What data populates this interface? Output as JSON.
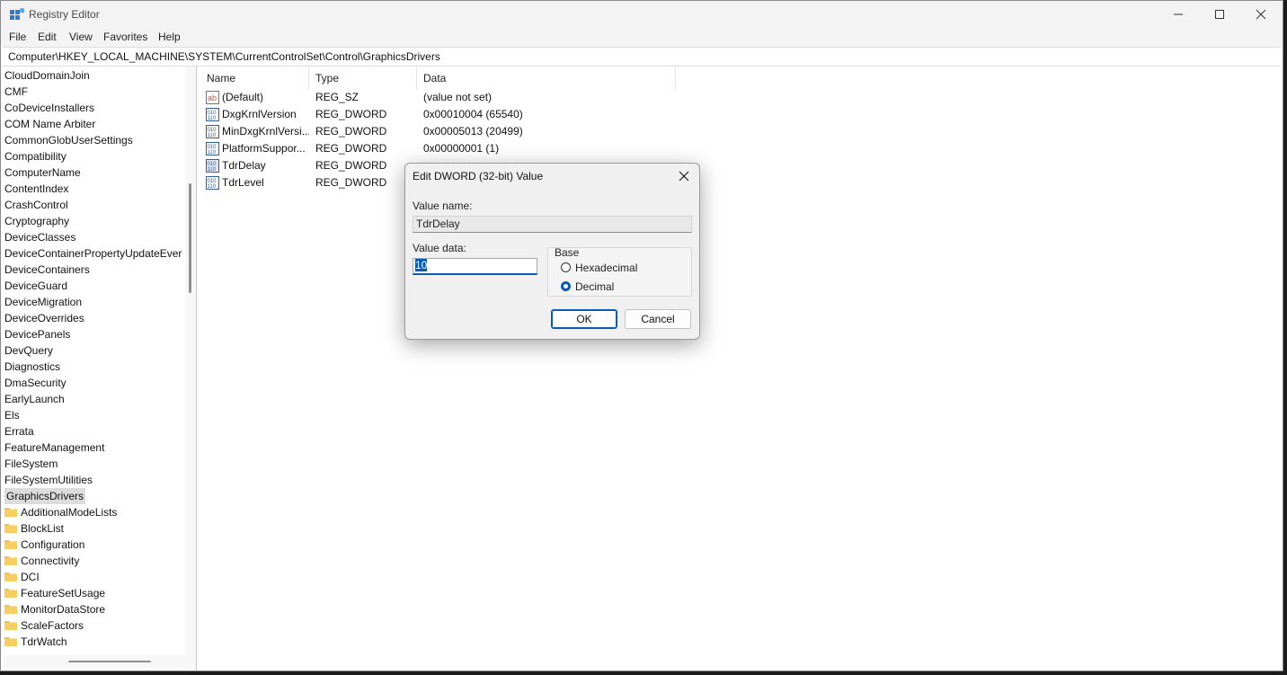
{
  "window": {
    "title": "Registry Editor",
    "controls": [
      "minimize",
      "maximize",
      "close"
    ]
  },
  "menu": [
    "File",
    "Edit",
    "View",
    "Favorites",
    "Help"
  ],
  "address": "Computer\\HKEY_LOCAL_MACHINE\\SYSTEM\\CurrentControlSet\\Control\\GraphicsDrivers",
  "tree": {
    "keys": [
      "CloudDomainJoin",
      "CMF",
      "CoDeviceInstallers",
      "COM Name Arbiter",
      "CommonGlobUserSettings",
      "Compatibility",
      "ComputerName",
      "ContentIndex",
      "CrashControl",
      "Cryptography",
      "DeviceClasses",
      "DeviceContainerPropertyUpdateEver",
      "DeviceContainers",
      "DeviceGuard",
      "DeviceMigration",
      "DeviceOverrides",
      "DevicePanels",
      "DevQuery",
      "Diagnostics",
      "DmaSecurity",
      "EarlyLaunch",
      "Els",
      "Errata",
      "FeatureManagement",
      "FileSystem",
      "FileSystemUtilities"
    ],
    "selected": "GraphicsDrivers",
    "children": [
      "AdditionalModeLists",
      "BlockList",
      "Configuration",
      "Connectivity",
      "DCI",
      "FeatureSetUsage",
      "MonitorDataStore",
      "ScaleFactors",
      "TdrWatch"
    ]
  },
  "list": {
    "columns": [
      "Name",
      "Type",
      "Data"
    ],
    "rows": [
      {
        "icon": "string-value-icon",
        "name": "(Default)",
        "type": "REG_SZ",
        "data": "(value not set)"
      },
      {
        "icon": "binary-value-icon",
        "name": "DxgKrnlVersion",
        "type": "REG_DWORD",
        "data": "0x00010004 (65540)"
      },
      {
        "icon": "binary-value-icon",
        "name": "MinDxgKrnlVersi...",
        "type": "REG_DWORD",
        "data": "0x00005013 (20499)"
      },
      {
        "icon": "binary-value-icon",
        "name": "PlatformSuppor...",
        "type": "REG_DWORD",
        "data": "0x00000001 (1)"
      },
      {
        "icon": "binary-value-icon",
        "name": "TdrDelay",
        "type": "REG_DWORD",
        "data": ""
      },
      {
        "icon": "binary-value-icon",
        "name": "TdrLevel",
        "type": "REG_DWORD",
        "data": ""
      }
    ]
  },
  "dialog": {
    "title": "Edit DWORD (32-bit) Value",
    "value_name_label": "Value name:",
    "value_name": "TdrDelay",
    "value_data_label": "Value data:",
    "value_data": "10",
    "base_label": "Base",
    "options": [
      {
        "label": "Hexadecimal",
        "checked": false
      },
      {
        "label": "Decimal",
        "checked": true
      }
    ],
    "ok_label": "OK",
    "cancel_label": "Cancel"
  },
  "colors": {
    "accent": "#0a5bb5",
    "folder": "#f2c04c",
    "selection": "#dcdcdc"
  }
}
